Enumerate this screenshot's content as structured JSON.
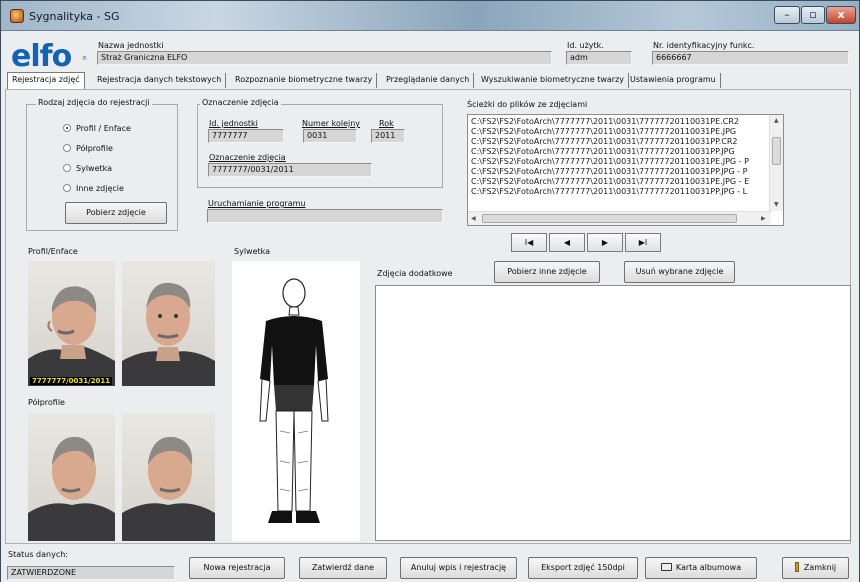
{
  "window": {
    "title": "Sygnalityka - SG"
  },
  "header": {
    "logo_text": "elfo",
    "unit_label": "Nazwa jednostki",
    "unit_value": "Straż Graniczna ELFO",
    "user_id_label": "Id. użytk.",
    "user_id_value": "adm",
    "func_id_label": "Nr. identyfikacyjny funkc.",
    "func_id_value": "6666667"
  },
  "tabs": [
    {
      "label": "Rejestracja zdjęć"
    },
    {
      "label": "Rejestracja danych tekstowych"
    },
    {
      "label": "Rozpoznanie biometryczne twarzy"
    },
    {
      "label": "Przeglądanie danych"
    },
    {
      "label": "Wyszukiwanie biometryczne twarzy"
    },
    {
      "label": "Ustawienia programu"
    }
  ],
  "photo_kind": {
    "title": "Rodzaj zdjęcia do rejestracji",
    "options": [
      "Profil / Enface",
      "Półprofile",
      "Sylwetka",
      "Inne zdjęcie"
    ],
    "selected": "Profil / Enface",
    "fetch_button": "Pobierz zdjęcie"
  },
  "photo_mark": {
    "title": "Oznaczenie zdjęcia",
    "unit_id_label": "Id. jednostki",
    "unit_id_value": "7777777",
    "seq_label": "Numer kolejny",
    "seq_value": "0031",
    "year_label": "Rok",
    "year_value": "2011",
    "mark_label": "Oznaczenie zdjęcia",
    "mark_value": "7777777/0031/2011"
  },
  "run_program": {
    "label": "Uruchamianie programu",
    "value": ""
  },
  "file_paths": {
    "label": "Ścieżki do plików ze zdjęciami",
    "rows": [
      "C:\\FS2\\FS2\\FotoArch\\7777777\\2011\\0031\\77777720110031PE.CR2",
      "C:\\FS2\\FS2\\FotoArch\\7777777\\2011\\0031\\77777720110031PE.JPG",
      "C:\\FS2\\FS2\\FotoArch\\7777777\\2011\\0031\\77777720110031PP.CR2",
      "C:\\FS2\\FS2\\FotoArch\\7777777\\2011\\0031\\77777720110031PP.JPG",
      "C:\\FS2\\FS2\\FotoArch\\7777777\\2011\\0031\\77777720110031PE.JPG - P",
      "C:\\FS2\\FS2\\FotoArch\\7777777\\2011\\0031\\77777720110031PP.JPG - P",
      "C:\\FS2\\FS2\\FotoArch\\7777777\\2011\\0031\\77777720110031PE.JPG - E",
      "C:\\FS2\\FS2\\FotoArch\\7777777\\2011\\0031\\77777720110031PP.JPG - L"
    ]
  },
  "nav": {
    "first": "I◀",
    "prev": "◀",
    "next": "▶",
    "last": "▶I"
  },
  "sections": {
    "profile_enface": "Profil/Enface",
    "semi_profiles": "Półprofile",
    "silhouette": "Sylwetka",
    "extra_photos": "Zdjęcia dodatkowe",
    "photo_caption": "7777777/0031/2011"
  },
  "extra_buttons": {
    "fetch_other": "Pobierz inne zdjęcie",
    "remove_selected": "Usuń wybrane zdjęcie"
  },
  "status": {
    "label": "Status danych:",
    "value": "ZATWIERDZONE",
    "new_registration": "Nowa rejestracja",
    "confirm": "Zatwierdź dane",
    "cancel": "Anuluj wpis i rejestrację",
    "export": "Eksport zdjęć 150dpi",
    "album_card": "Karta albumowa",
    "close": "Zamknij"
  },
  "colors": {
    "logo_blue": "#1262b8",
    "caption_yellow": "#f5e200"
  }
}
